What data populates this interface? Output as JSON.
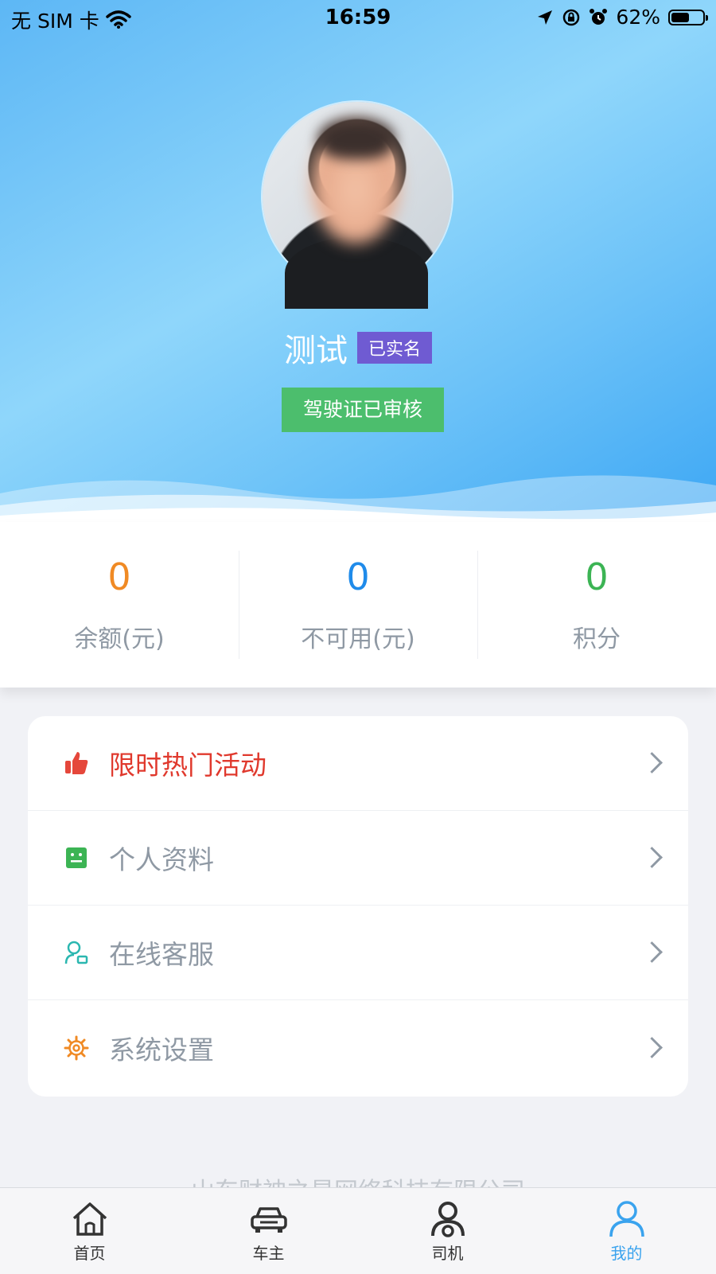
{
  "status_bar": {
    "carrier": "无 SIM 卡",
    "time": "16:59",
    "battery": "62%",
    "battery_level": 0.62
  },
  "profile": {
    "name": "测试",
    "verified_badge": "已实名",
    "license_badge": "驾驶证已审核",
    "avatar_icon": "avatar-photo"
  },
  "stats": [
    {
      "value": "0",
      "label": "余额(元)",
      "color": "#f08a24"
    },
    {
      "value": "0",
      "label": "不可用(元)",
      "color": "#1f8bea"
    },
    {
      "value": "0",
      "label": "积分",
      "color": "#3cb454"
    }
  ],
  "menu": [
    {
      "label": "限时热门活动",
      "icon": "thumbs-up-icon",
      "color": "#e5473b",
      "highlight": true
    },
    {
      "label": "个人资料",
      "icon": "profile-card-icon",
      "color": "#3cb454"
    },
    {
      "label": "在线客服",
      "icon": "customer-service-icon",
      "color": "#2bb7b0"
    },
    {
      "label": "系统设置",
      "icon": "gear-icon",
      "color": "#f08a24"
    }
  ],
  "footer": "山东财神之星网络科技有限公司",
  "tabs": [
    {
      "label": "首页",
      "icon": "home-icon"
    },
    {
      "label": "车主",
      "icon": "car-icon"
    },
    {
      "label": "司机",
      "icon": "driver-icon"
    },
    {
      "label": "我的",
      "icon": "user-icon",
      "active": true
    }
  ]
}
